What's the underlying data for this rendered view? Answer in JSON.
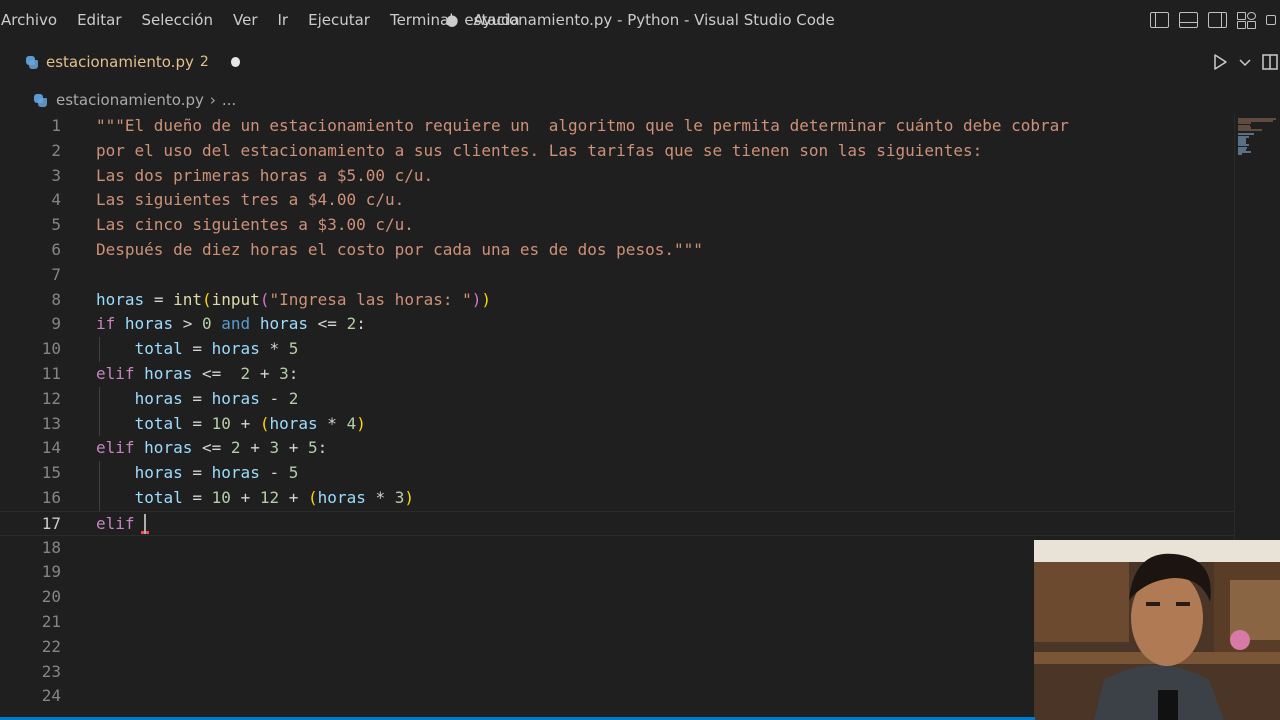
{
  "menu": [
    "Archivo",
    "Editar",
    "Selección",
    "Ver",
    "Ir",
    "Ejecutar",
    "Terminal",
    "Ayuda"
  ],
  "window_title": "estacionamiento.py - Python - Visual Studio Code",
  "window_dirty_dot": "●",
  "tab": {
    "filename": "estacionamiento.py",
    "problem_count": "2"
  },
  "breadcrumb": {
    "file": "estacionamiento.py",
    "separator": "›",
    "more": "..."
  },
  "editor": {
    "active_line": 17,
    "lines": [
      "\"\"\"El dueño de un estacionamiento requiere un  algoritmo que le permita determinar cuánto debe cobrar",
      "por el uso del estacionamiento a sus clientes. Las tarifas que se tienen son las siguientes:",
      "Las dos primeras horas a $5.00 c/u.",
      "Las siguientes tres a $4.00 c/u.",
      "Las cinco siguientes a $3.00 c/u.",
      "Después de diez horas el costo por cada una es de dos pesos.\"\"\"",
      "",
      "horas = int(input(\"Ingresa las horas: \"))",
      "if horas > 0 and horas <= 2:",
      "    total = horas * 5",
      "elif horas <=  2 + 3:",
      "    horas = horas - 2",
      "    total = 10 + (horas * 4)",
      "elif horas <= 2 + 3 + 5:",
      "    horas = horas - 5",
      "    total = 10 + 12 + (horas * 3)",
      "elif ",
      "",
      "",
      "",
      "",
      "",
      "",
      ""
    ]
  },
  "colors": {
    "string": "#ce9178",
    "keyword": "#c586c0",
    "variable": "#9cdcfe",
    "function": "#dcdcaa",
    "number": "#b5cea8",
    "logical": "#569cd6",
    "modified_tab": "#e2c08d",
    "status_accent": "#007acc"
  },
  "icons": {
    "file": "python-icon",
    "title_controls": [
      "toggle-primary-sidebar-icon",
      "toggle-panel-icon",
      "toggle-secondary-sidebar-icon",
      "customize-layout-icon",
      "minimize-icon"
    ],
    "editor_actions": [
      "run-python-file-icon",
      "run-options-chevron-icon",
      "split-editor-icon"
    ]
  }
}
